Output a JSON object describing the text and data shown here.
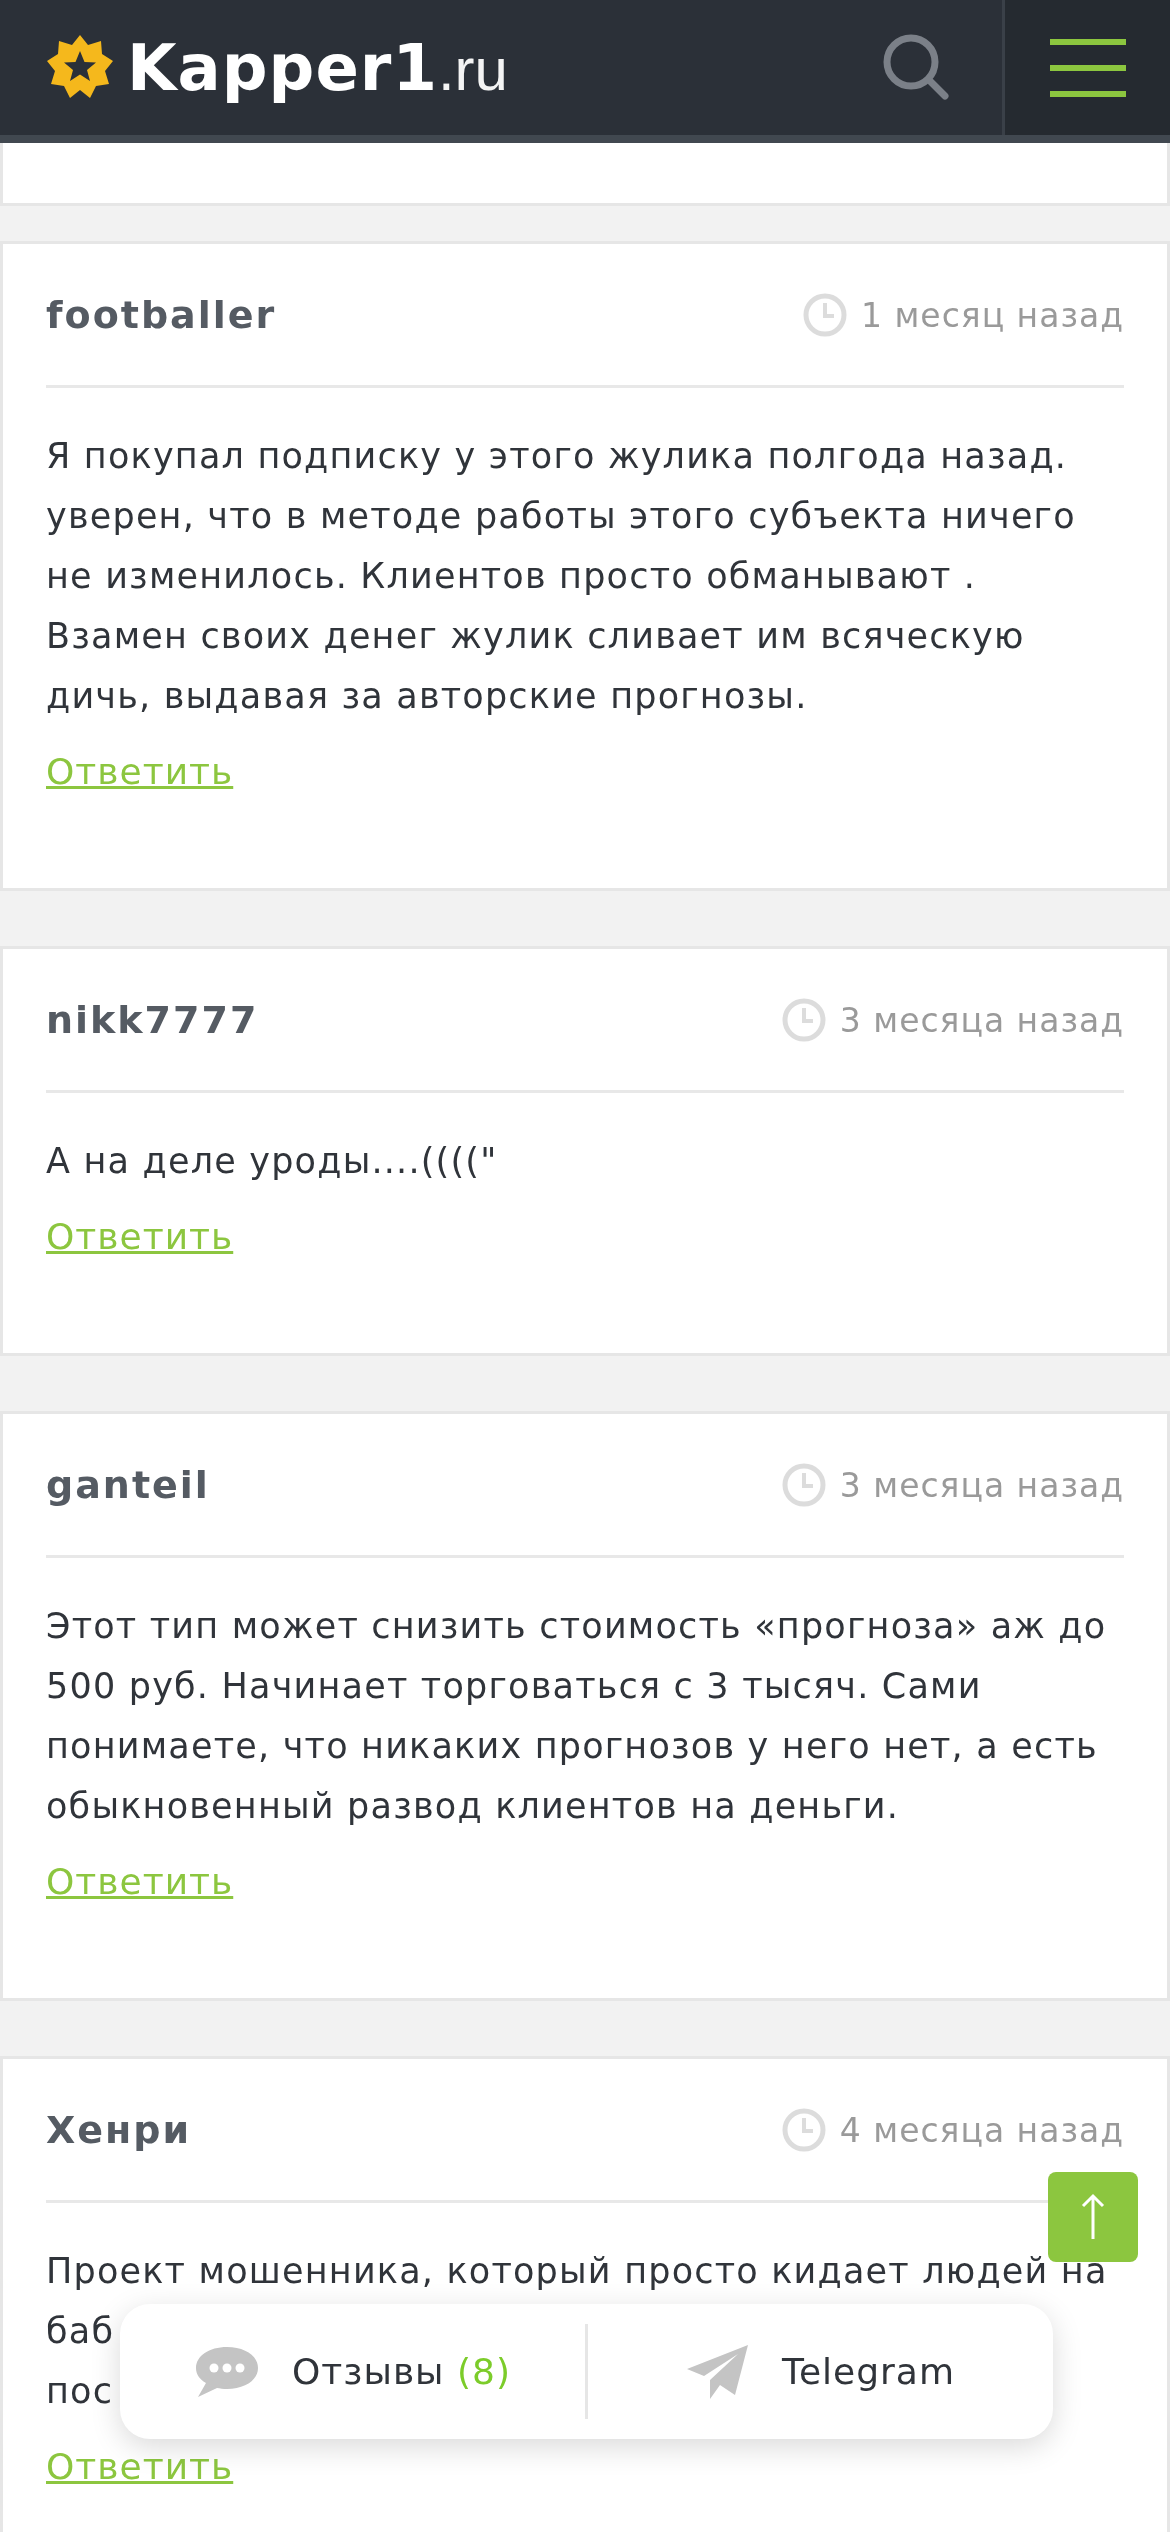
{
  "header": {
    "logo_main": "Kapper1",
    "logo_suffix": ".ru"
  },
  "comments": [
    {
      "author": "footballer",
      "time": "1 месяц назад",
      "text": "Я покупал подписку у этого жулика полгода назад. уверен, что в методе работы этого субъекта ничего не изменилось. Клиентов просто обманывают . Взамен своих денег жулик сливает им всяческую дичь, выдавая за авторские прогнозы.",
      "reply": "Ответить"
    },
    {
      "author": "nikk7777",
      "time": "3 месяца назад",
      "text": "А на деле уроды....((((\"",
      "reply": "Ответить"
    },
    {
      "author": "ganteil",
      "time": "3 месяца назад",
      "text": "Этот тип может снизить стоимость «прогноза» аж до 500 руб. Начинает торговаться с 3 тысяч. Сами понимаете, что никаких прогнозов у него нет, а есть обыкновенный развод клиентов на деньги.",
      "reply": "Ответить"
    },
    {
      "author": "Хенри",
      "time": "4 месяца назад",
      "lines": [
        "Проект мошенника, который просто кидает людей на",
        "баб",
        "пос"
      ],
      "reply": "Ответить"
    }
  ],
  "bottom_bar": {
    "reviews_label": "Отзывы",
    "reviews_count": "(8)",
    "telegram_label": "Telegram"
  }
}
